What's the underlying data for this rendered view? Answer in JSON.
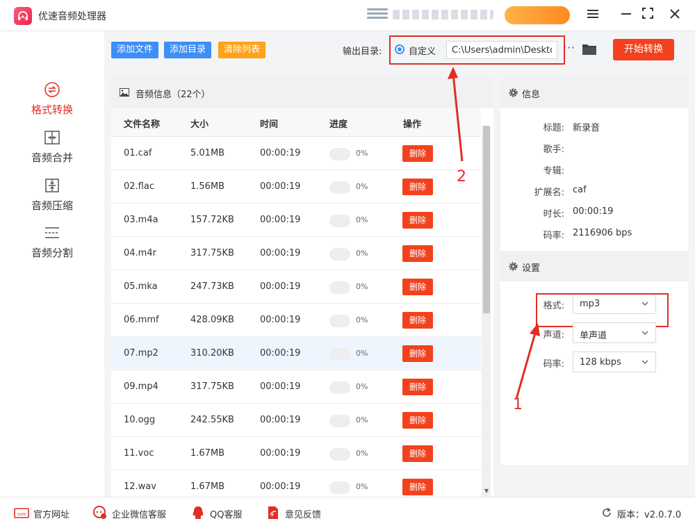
{
  "app": {
    "title": "优速音频处理器",
    "accent_color": "#e02e24",
    "primary_color": "#3d8ef7",
    "icons": {
      "logo": "headphones-icon",
      "minimize": "minimize-icon",
      "maximize": "maximize-icon",
      "close": "close-icon",
      "menu": "menu-icon"
    }
  },
  "sidebar": {
    "items": [
      {
        "label": "格式转换",
        "icon": "convert-icon",
        "active": true
      },
      {
        "label": "音频合并",
        "icon": "merge-icon",
        "active": false
      },
      {
        "label": "音频压缩",
        "icon": "compress-icon",
        "active": false
      },
      {
        "label": "音频分割",
        "icon": "split-icon",
        "active": false
      }
    ]
  },
  "toolbar": {
    "add_file": "添加文件",
    "add_folder": "添加目录",
    "clear_list": "清除列表",
    "output_label": "输出目录:",
    "custom_option": "自定义",
    "output_path": "C:\\Users\\admin\\Desktop",
    "more": "···",
    "start": "开始转换"
  },
  "annotations": {
    "one": "1",
    "two": "2"
  },
  "files": {
    "header": "音频信息（22个）",
    "columns": {
      "name": "文件名称",
      "size": "大小",
      "time": "时间",
      "progress": "进度",
      "action": "操作"
    },
    "delete_label": "删除",
    "rows": [
      {
        "name": "01.caf",
        "size": "5.01MB",
        "time": "00:00:19",
        "progress": "0%",
        "progress_value": 0
      },
      {
        "name": "02.flac",
        "size": "1.56MB",
        "time": "00:00:19",
        "progress": "0%",
        "progress_value": 0
      },
      {
        "name": "03.m4a",
        "size": "157.72KB",
        "time": "00:00:19",
        "progress": "0%",
        "progress_value": 0
      },
      {
        "name": "04.m4r",
        "size": "317.75KB",
        "time": "00:00:19",
        "progress": "0%",
        "progress_value": 0
      },
      {
        "name": "05.mka",
        "size": "247.73KB",
        "time": "00:00:19",
        "progress": "0%",
        "progress_value": 0
      },
      {
        "name": "06.mmf",
        "size": "428.09KB",
        "time": "00:00:19",
        "progress": "0%",
        "progress_value": 0
      },
      {
        "name": "07.mp2",
        "size": "310.20KB",
        "time": "00:00:19",
        "progress": "0%",
        "progress_value": 0,
        "selected": true
      },
      {
        "name": "09.mp4",
        "size": "317.75KB",
        "time": "00:00:19",
        "progress": "0%",
        "progress_value": 0
      },
      {
        "name": "10.ogg",
        "size": "242.55KB",
        "time": "00:00:19",
        "progress": "0%",
        "progress_value": 0
      },
      {
        "name": "11.voc",
        "size": "1.67MB",
        "time": "00:00:19",
        "progress": "0%",
        "progress_value": 0
      },
      {
        "name": "12.wav",
        "size": "1.67MB",
        "time": "00:00:19",
        "progress": "0%",
        "progress_value": 0
      }
    ]
  },
  "info": {
    "header": "信息",
    "fields": [
      {
        "key": "标题:",
        "value": "新录音"
      },
      {
        "key": "歌手:",
        "value": ""
      },
      {
        "key": "专辑:",
        "value": ""
      },
      {
        "key": "扩展名:",
        "value": "caf"
      },
      {
        "key": "时长:",
        "value": "00:00:19"
      },
      {
        "key": "码率:",
        "value": "2116906 bps"
      }
    ]
  },
  "settings": {
    "header": "设置",
    "format": {
      "label": "格式:",
      "value": "mp3"
    },
    "channel": {
      "label": "声道:",
      "value": "单声道"
    },
    "bitrate": {
      "label": "码率:",
      "value": "128 kbps"
    }
  },
  "footer": {
    "website": "官方网址",
    "wechat": "企业微信客服",
    "qq": "QQ客服",
    "feedback": "意见反馈",
    "version": "版本：v2.0.7.0"
  }
}
